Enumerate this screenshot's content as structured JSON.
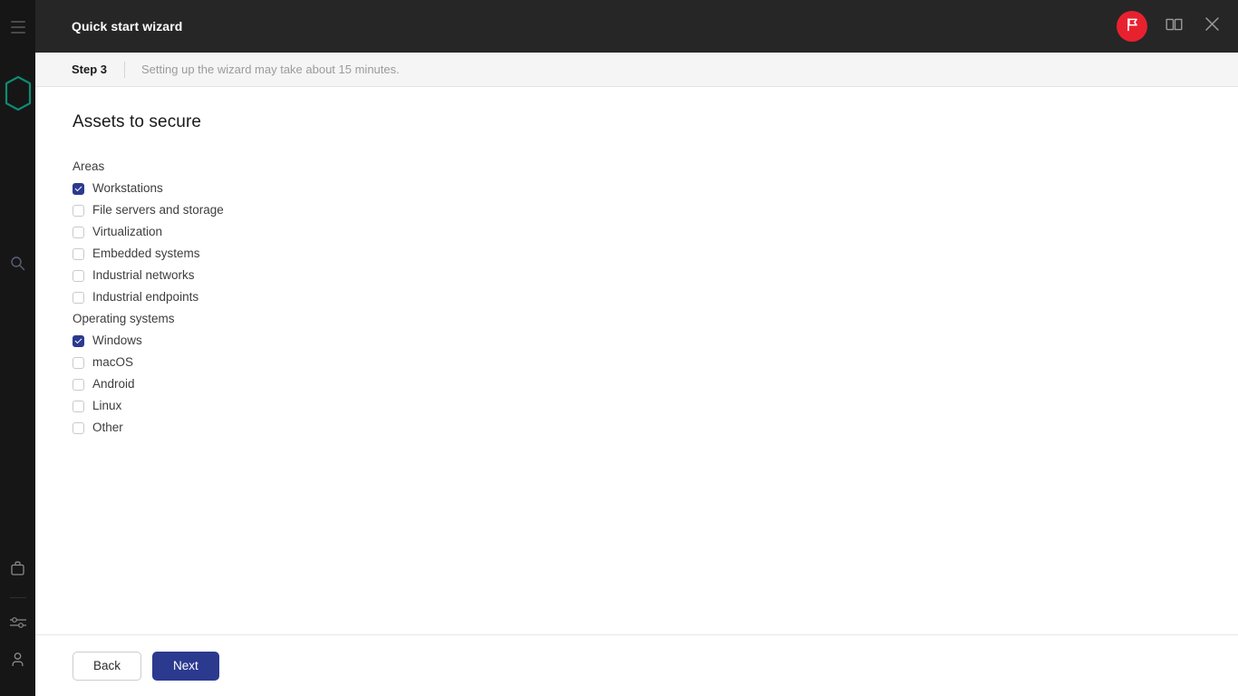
{
  "window": {
    "title": "Quick start wizard",
    "actions": [
      {
        "name": "notifications-flag-button",
        "icon": "flag-icon"
      },
      {
        "name": "help-book-button",
        "icon": "book-icon"
      },
      {
        "name": "close-window-button",
        "icon": "close-icon"
      }
    ]
  },
  "rail": {
    "menu_icon": "hamburger-menu-icon",
    "logo_icon": "hexagon-logo-icon",
    "items": [
      {
        "name": "search",
        "icon": "search-icon"
      },
      {
        "name": "assets",
        "icon": "briefcase-icon"
      },
      {
        "name": "settings",
        "icon": "sliders-icon"
      },
      {
        "name": "account",
        "icon": "user-icon"
      }
    ]
  },
  "stepbar": {
    "step": "Step 3",
    "note": "Setting up the wizard may take about 15 minutes."
  },
  "main": {
    "title": "Assets to secure",
    "groups": [
      {
        "label": "Areas",
        "options": [
          {
            "label": "Workstations",
            "checked": true
          },
          {
            "label": "File servers and storage",
            "checked": false
          },
          {
            "label": "Virtualization",
            "checked": false
          },
          {
            "label": "Embedded systems",
            "checked": false
          },
          {
            "label": "Industrial networks",
            "checked": false
          },
          {
            "label": "Industrial endpoints",
            "checked": false
          }
        ]
      },
      {
        "label": "Operating systems",
        "options": [
          {
            "label": "Windows",
            "checked": true
          },
          {
            "label": "macOS",
            "checked": false
          },
          {
            "label": "Android",
            "checked": false
          },
          {
            "label": "Linux",
            "checked": false
          },
          {
            "label": "Other",
            "checked": false
          }
        ]
      }
    ]
  },
  "footer": {
    "back_label": "Back",
    "next_label": "Next"
  },
  "colors": {
    "accent": "#2b3a8f",
    "badge": "#e8212f",
    "logo": "#0f8a72",
    "titlebar": "#262626",
    "rail": "#161616"
  }
}
